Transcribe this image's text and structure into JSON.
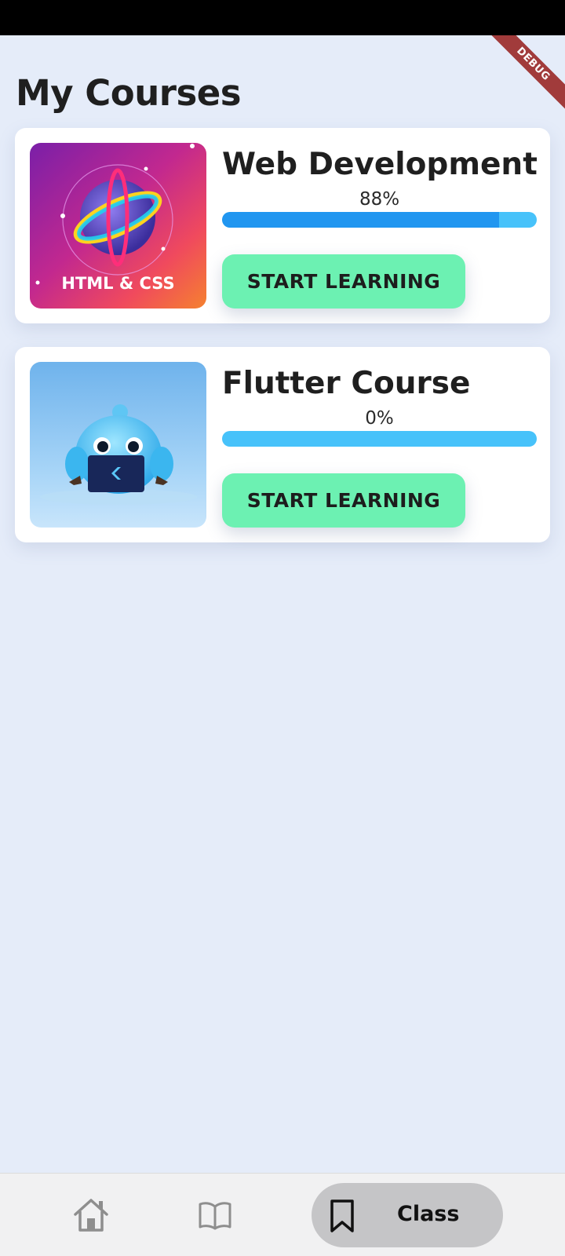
{
  "debug_banner": "DEBUG",
  "page": {
    "title": "My Courses"
  },
  "courses": [
    {
      "title": "Web Development",
      "percent_label": "88%",
      "progress": 0.88,
      "button_label": "START LEARNING",
      "image_caption": "HTML & CSS"
    },
    {
      "title": "Flutter Course",
      "percent_label": "0%",
      "progress": 0,
      "button_label": "START LEARNING"
    }
  ],
  "bottom_nav": {
    "items": [
      {
        "icon": "home-icon"
      },
      {
        "icon": "book-icon"
      },
      {
        "icon": "bookmark-icon",
        "label": "Class",
        "active": true
      }
    ]
  },
  "colors": {
    "background": "#e5ecf9",
    "progress_fill": "#2196f0",
    "progress_track": "#47c2fa",
    "button": "#6cf1b2",
    "active_nav_pill": "#c5c5c7"
  }
}
